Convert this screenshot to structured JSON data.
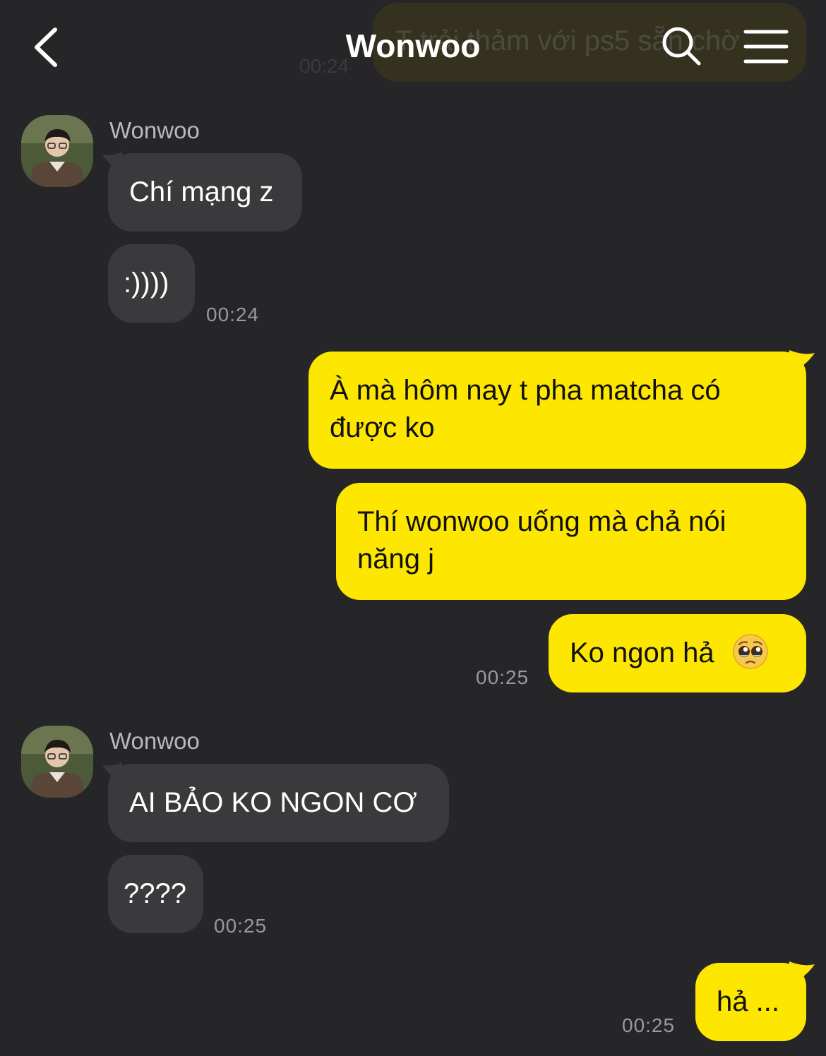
{
  "header": {
    "title": "Wonwoo",
    "ghost_message": "T trải thảm với ps5 sẵn chờ",
    "ghost_time": "00:24"
  },
  "messages": [
    {
      "id": "m1",
      "sender_name": "Wonwoo",
      "text": "Chí mạng z"
    },
    {
      "id": "m2",
      "text": ":))))",
      "time": "00:24"
    },
    {
      "id": "m3",
      "line1": "À mà hôm nay t pha matcha có",
      "line2": "được ko"
    },
    {
      "id": "m4",
      "line1": "Thí wonwoo uống mà chả nói",
      "line2": "năng j"
    },
    {
      "id": "m5",
      "text": "Ko ngon hả",
      "emoji": "pleading-face-emoji",
      "time": "00:25"
    },
    {
      "id": "m6",
      "sender_name": "Wonwoo",
      "text": "AI BẢO KO NGON CƠ"
    },
    {
      "id": "m7",
      "text": "????",
      "time": "00:25"
    },
    {
      "id": "m8",
      "text": "hả ...",
      "time": "00:25"
    }
  ],
  "colors": {
    "background": "#262628",
    "incoming_bubble": "#3a3a3c",
    "outgoing_bubble": "#fde600",
    "timestamp": "#9a9a9c"
  }
}
